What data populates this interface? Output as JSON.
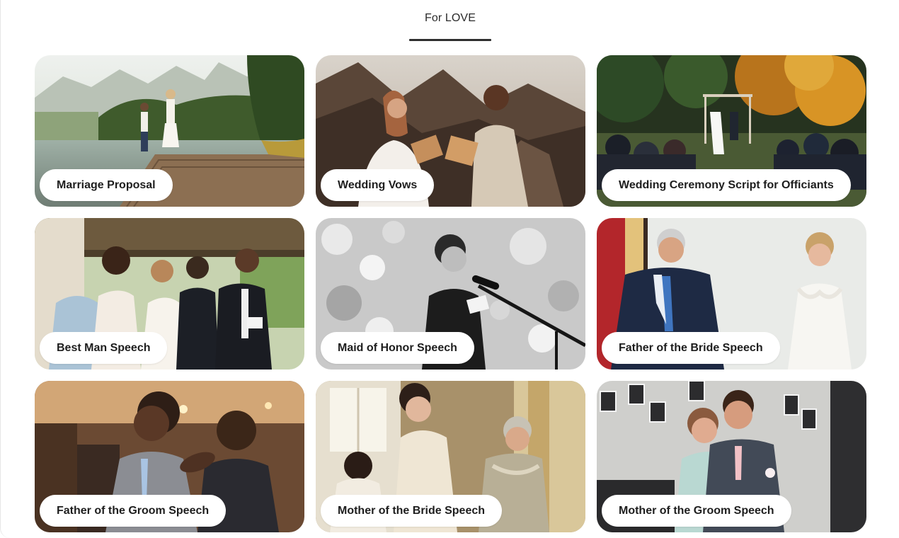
{
  "tabs": [
    {
      "label": "For LOVE",
      "active": true
    }
  ],
  "cards": [
    {
      "title": "Marriage Proposal",
      "image": "couple proposing on lake dock"
    },
    {
      "title": "Wedding Vows",
      "image": "couple reading vows on rocks"
    },
    {
      "title": "Wedding Ceremony Script for Officiants",
      "image": "outdoor ceremony in autumn forest"
    },
    {
      "title": "Best Man Speech",
      "image": "best man giving toast to wedding party"
    },
    {
      "title": "Maid of Honor Speech",
      "image": "maid of honor speaking into microphone"
    },
    {
      "title": "Father of the Bride Speech",
      "image": "father seeing bride in dress"
    },
    {
      "title": "Father of the Groom Speech",
      "image": "father embracing groom at reception"
    },
    {
      "title": "Mother of the Bride Speech",
      "image": "mother helping bride with dress"
    },
    {
      "title": "Mother of the Groom Speech",
      "image": "mother hugging groom"
    }
  ]
}
